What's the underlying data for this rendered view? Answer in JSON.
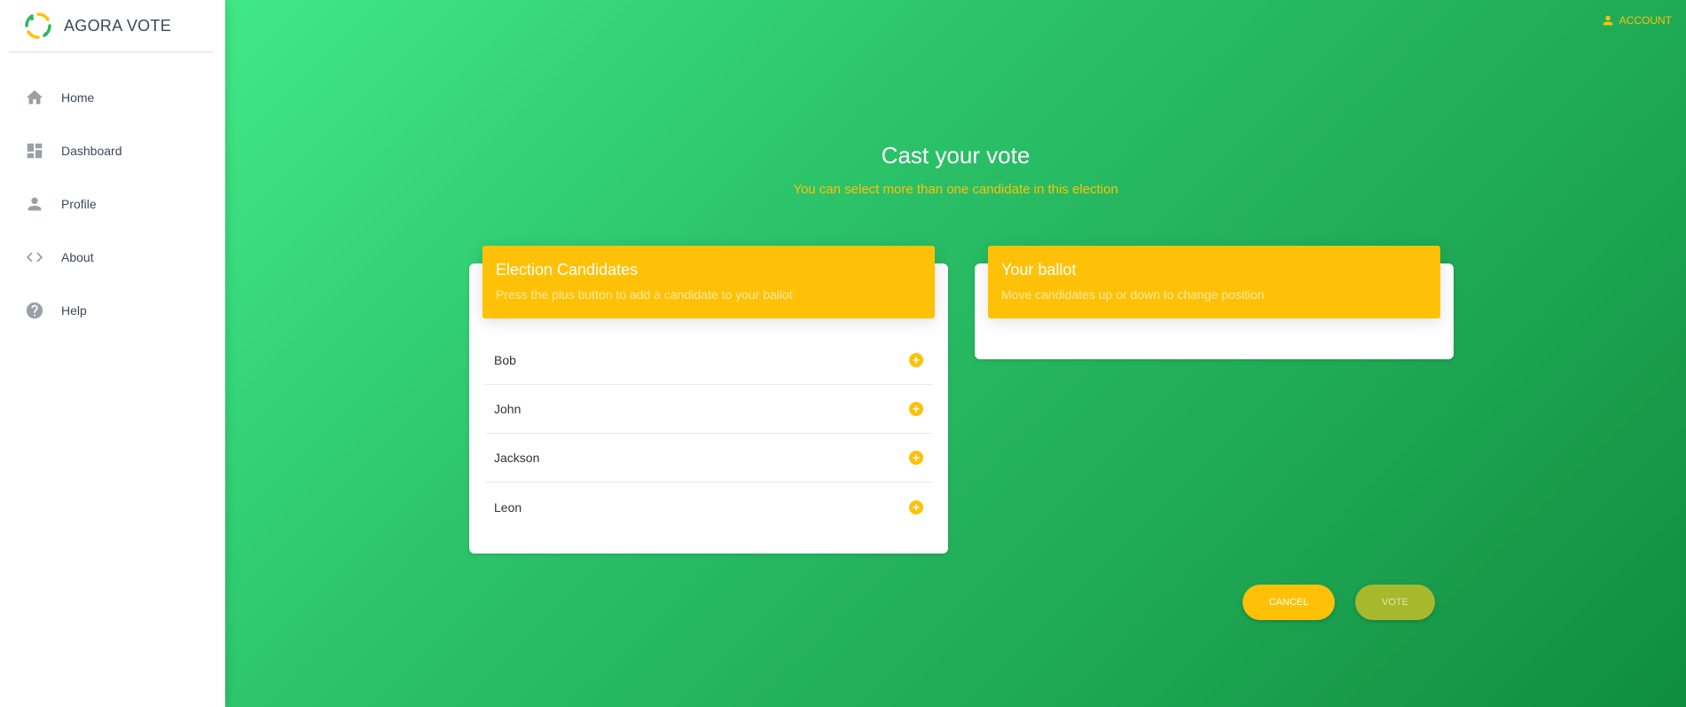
{
  "app": {
    "name": "AGORA VOTE"
  },
  "sidebar": {
    "items": [
      {
        "label": "Home",
        "icon": "home-icon"
      },
      {
        "label": "Dashboard",
        "icon": "dashboard-icon"
      },
      {
        "label": "Profile",
        "icon": "person-icon"
      },
      {
        "label": "About",
        "icon": "code-icon"
      },
      {
        "label": "Help",
        "icon": "help-icon"
      }
    ]
  },
  "header": {
    "account_label": "ACCOUNT"
  },
  "main": {
    "title": "Cast your vote",
    "subtitle": "You can select more than one candidate in this election"
  },
  "candidates_card": {
    "title": "Election Candidates",
    "subtitle": "Press the plus button to add a candidate to your ballot",
    "candidates": [
      "Bob",
      "John",
      "Jackson",
      "Leon"
    ]
  },
  "ballot_card": {
    "title": "Your ballot",
    "subtitle": "Move candidates up or down to change position"
  },
  "actions": {
    "cancel_label": "CANCEL",
    "vote_label": "VOTE"
  },
  "colors": {
    "accent": "#ffc107",
    "brand_green": "#1ea854",
    "sidebar_text": "#3c4858",
    "icon_grey": "#9aa0a6"
  }
}
